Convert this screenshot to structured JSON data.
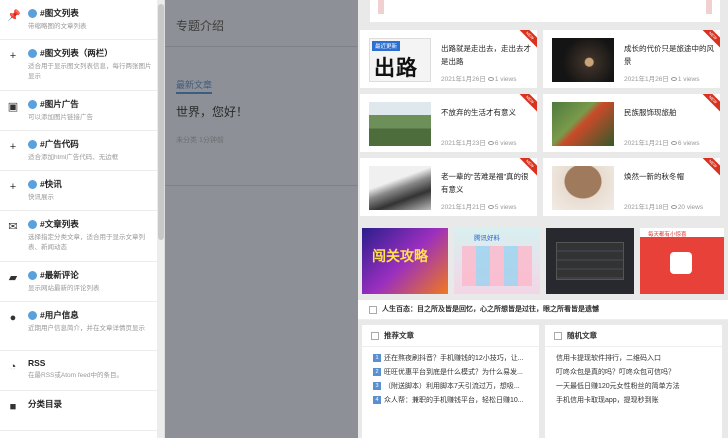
{
  "widgets": [
    {
      "icon": "pin-icon",
      "glyph": "📌",
      "title": "#图文列表",
      "desc": "带缩略图的文章列表"
    },
    {
      "icon": "plus-icon",
      "glyph": "+",
      "title": "#图文列表（两栏）",
      "desc": "适合用于显示图文列表信息，每行两张图片显示"
    },
    {
      "icon": "image-icon",
      "glyph": "▣",
      "title": "#图片广告",
      "desc": "可以添加图片链接广告"
    },
    {
      "icon": "plus-icon",
      "glyph": "+",
      "title": "#广告代码",
      "desc": "适合添加html广告代码、无边框"
    },
    {
      "icon": "plus-icon",
      "glyph": "+",
      "title": "#快讯",
      "desc": "快讯展示"
    },
    {
      "icon": "mail-icon",
      "glyph": "✉",
      "title": "#文章列表",
      "desc": "选择指定分类文章，适合用于显示文章列表、新闻动态"
    },
    {
      "icon": "comment-icon",
      "glyph": "▰",
      "title": "#最新评论",
      "desc": "显示网站最新的评论列表"
    },
    {
      "icon": "user-icon",
      "glyph": "●",
      "title": "#用户信息",
      "desc": "近期用户信息简介，并在文章详情页显示"
    },
    {
      "icon": "rss-icon",
      "glyph": "◔",
      "title": "RSS",
      "desc": "在最RSS或Atom feed中的条目。"
    },
    {
      "icon": "folder-icon",
      "glyph": "■",
      "title": "分类目录",
      "desc": ""
    }
  ],
  "middle": {
    "topic": "专题介绍",
    "new_articles": "最新文章",
    "hello": "世界，您好！",
    "meta": "未分类    1分钟前"
  },
  "cards": [
    {
      "title": "出路就是走出去，走出去才是出路",
      "date": "2021年1月26日",
      "views": "1 views",
      "ribbon": "NEW"
    },
    {
      "title": "成长的代价只是旅途中的风景",
      "date": "2021年1月26日",
      "views": "1 views",
      "ribbon": "NEW"
    },
    {
      "title": "不放弃的生活才有意义",
      "date": "2021年1月23日",
      "views": "6 views",
      "ribbon": "NEW"
    },
    {
      "title": "民族服饰现旅舶",
      "date": "2021年1月21日",
      "views": "6 views",
      "ribbon": "NEW"
    },
    {
      "title": "老一辈的“苦难是福”真的很有意义",
      "date": "2021年1月21日",
      "views": "5 views",
      "ribbon": "NEW"
    },
    {
      "title": "焕然一新的秋冬帽",
      "date": "2021年1月18日",
      "views": "20 views",
      "ribbon": "NEW"
    }
  ],
  "card1_badge": "最近更新",
  "card1_big": "出路",
  "banners": [
    {
      "text": "闯关攻略"
    },
    {
      "text": "腾讯好料"
    },
    {
      "text": ""
    },
    {
      "text": "每天都有小惊喜"
    }
  ],
  "notice": "人生百态：目之所及皆是回忆，心之所想皆是过往，眼之所看皆是遗憾",
  "recommend": {
    "title": "推荐文章",
    "items": [
      "还在熬夜刷抖音？手机赚钱的12小技巧，让...",
      "旺旺优惠平台到底是什么模式？为什么易发...",
      "（附送脚本）利用脚本7天引流过万，想吸...",
      "众人帮：兼职的手机赚钱平台，轻松日赚10..."
    ]
  },
  "random": {
    "title": "随机文章",
    "items": [
      "信用卡提现软件排行，二维码入口",
      "叮咚众包是真的吗？叮咚众包可信吗？",
      "一天最低日赚120元女性粉丝的简单方法",
      "手机信用卡取现app，提现秒到账"
    ]
  }
}
